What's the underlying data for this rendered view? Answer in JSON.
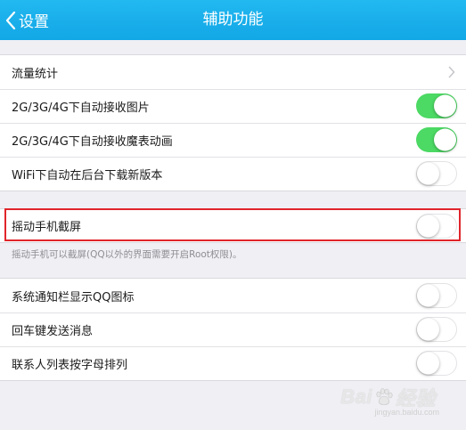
{
  "header": {
    "back_label": "设置",
    "title": "辅助功能",
    "bg_color": "#1badea"
  },
  "group1": {
    "items": [
      {
        "label": "流量统计",
        "control": "chevron-right-icon"
      },
      {
        "label": "2G/3G/4G下自动接收图片",
        "toggle": "on"
      },
      {
        "label": "2G/3G/4G下自动接收魔表动画",
        "toggle": "on"
      },
      {
        "label": "WiFi下自动在后台下载新版本",
        "toggle": "off"
      }
    ]
  },
  "group2": {
    "items": [
      {
        "label": "摇动手机截屏",
        "toggle": "off"
      }
    ],
    "hint": "摇动手机可以截屏(QQ以外的界面需要开启Root权限)。"
  },
  "group3": {
    "items": [
      {
        "label": "系统通知栏显示QQ图标",
        "toggle": "off"
      },
      {
        "label": "回车键发送消息",
        "toggle": "off"
      },
      {
        "label": "联系人列表按字母排列",
        "toggle": "off"
      }
    ]
  },
  "colors": {
    "toggle_on": "#4cd964",
    "highlight_border": "#e0252b",
    "background": "#efeff4"
  },
  "watermark": {
    "text_left": "Bai",
    "text_right": "经验",
    "sub": "jingyan.baidu.com"
  }
}
